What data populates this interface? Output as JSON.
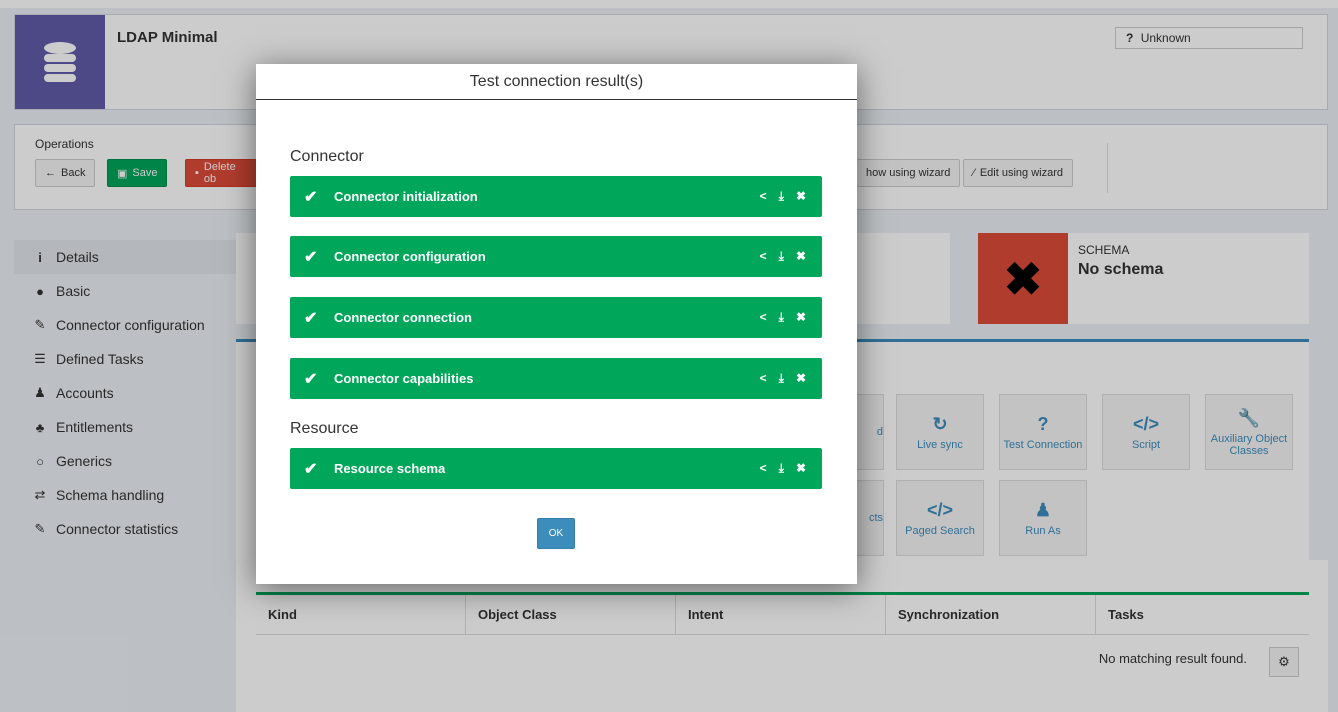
{
  "header": {
    "title": "LDAP Minimal",
    "status_icon": "?",
    "status_text": "Unknown"
  },
  "operations": {
    "label": "Operations",
    "back_label": "Back",
    "save_label": "Save",
    "delete_label": "Delete ob",
    "show_wizard_label": "how using wizard",
    "edit_wizard_label": "Edit using wizard"
  },
  "sidebar": {
    "items": [
      {
        "label": "Details",
        "icon": "info-icon"
      },
      {
        "label": "Basic",
        "icon": "circle-icon"
      },
      {
        "label": "Connector configuration",
        "icon": "plug-icon"
      },
      {
        "label": "Defined Tasks",
        "icon": "tasks-icon"
      },
      {
        "label": "Accounts",
        "icon": "user-icon"
      },
      {
        "label": "Entitlements",
        "icon": "users-icon"
      },
      {
        "label": "Generics",
        "icon": "circle-outline-icon"
      },
      {
        "label": "Schema handling",
        "icon": "exchange-icon"
      },
      {
        "label": "Connector statistics",
        "icon": "plug-icon"
      }
    ]
  },
  "schema": {
    "label": "SCHEMA",
    "value": "No schema",
    "color": "#dd4b39"
  },
  "tiles": {
    "live_sync": "Live sync",
    "test_connection": "Test Connection",
    "script": "Script",
    "aux": "Auxiliary Object Classes",
    "paged_search": "Paged Search",
    "run_as": "Run As",
    "partial_d": "d",
    "partial_cts": "cts"
  },
  "table": {
    "columns": [
      "Kind",
      "Object Class",
      "Intent",
      "Synchronization",
      "Tasks"
    ],
    "empty_text": "No matching result found."
  },
  "modal": {
    "title": "Test connection result(s)",
    "sections": [
      {
        "title": "Connector",
        "results": [
          "Connector initialization",
          "Connector configuration",
          "Connector connection",
          "Connector capabilities"
        ]
      },
      {
        "title": "Resource",
        "results": [
          "Resource schema"
        ]
      }
    ],
    "ok_label": "OK",
    "success_color": "#00a65a"
  }
}
